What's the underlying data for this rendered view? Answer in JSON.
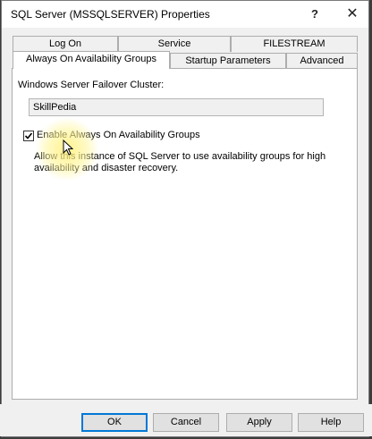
{
  "window": {
    "title": "SQL Server (MSSQLSERVER) Properties",
    "help_glyph": "?",
    "close_glyph": "✕"
  },
  "tabs": {
    "back_row": [
      "Log On",
      "Service",
      "FILESTREAM"
    ],
    "front_row": [
      "Always On Availability Groups",
      "Startup Parameters",
      "Advanced"
    ],
    "selected": "Always On Availability Groups"
  },
  "panel": {
    "cluster_label": "Windows Server Failover Cluster:",
    "cluster_value": "SkillPedia",
    "enable_checkbox_label": "Enable Always On Availability Groups",
    "enable_checked": true,
    "description": "Allow this instance of SQL Server to use availability groups for high availability and disaster recovery."
  },
  "buttons": {
    "ok": "OK",
    "cancel": "Cancel",
    "apply": "Apply",
    "help": "Help"
  },
  "colors": {
    "accent": "#0078d7",
    "highlight": "#fff078"
  }
}
